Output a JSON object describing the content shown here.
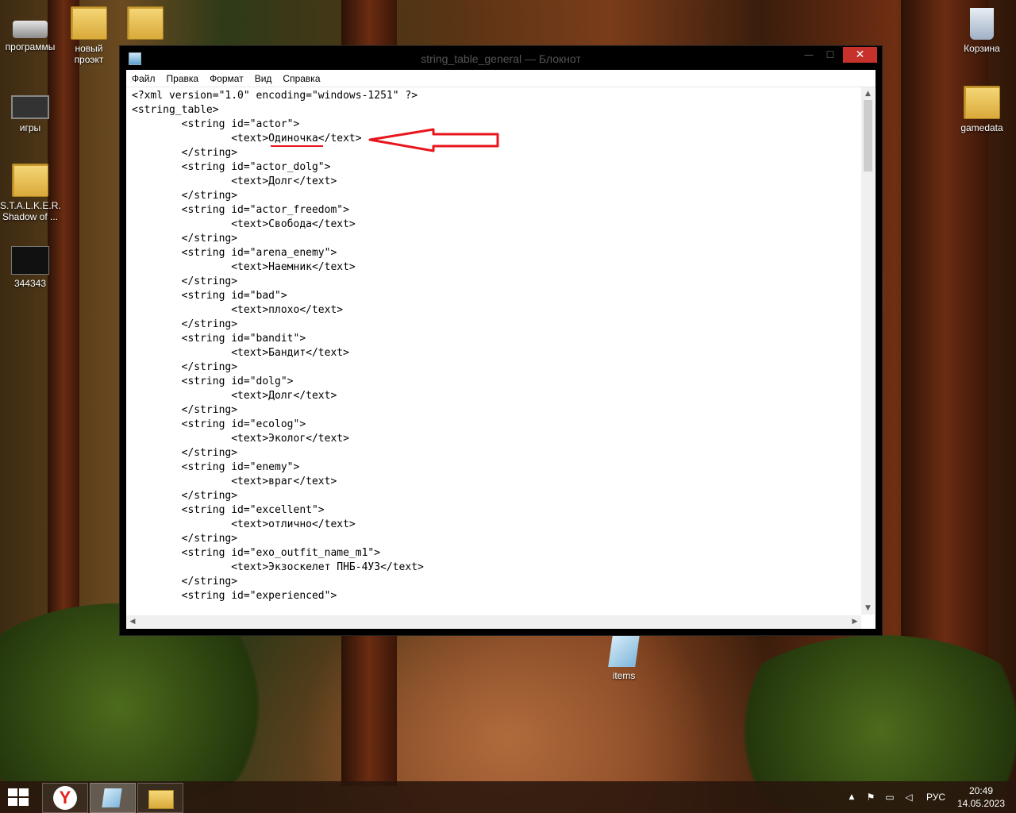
{
  "desktop": {
    "icons": [
      {
        "label": "программы",
        "icon": "drive-icon"
      },
      {
        "label": "новый\nпроэкт",
        "icon": "folder-icon"
      },
      {
        "label": "",
        "icon": "folder-icon"
      },
      {
        "label": "игры",
        "icon": "chip-icon"
      },
      {
        "label": "S.T.A.L.K.E.R.\nShadow of ...",
        "icon": "folder-icon"
      },
      {
        "label": "344343",
        "icon": "image-thumbnail-icon"
      },
      {
        "label": "Корзина",
        "icon": "recycle-bin-icon"
      },
      {
        "label": "gamedata",
        "icon": "folder-icon"
      },
      {
        "label": "items",
        "icon": "notepad-file-icon"
      }
    ]
  },
  "window": {
    "title": "string_table_general — Блокнот",
    "minimize": "—",
    "maximize": "☐",
    "close": "✕",
    "menu": [
      "Файл",
      "Правка",
      "Формат",
      "Вид",
      "Справка"
    ],
    "lines": [
      "<?xml version=\"1.0\" encoding=\"windows-1251\" ?>",
      "<string_table>",
      "        <string id=\"actor\">",
      "                <text>Одиночка</text>",
      "        </string>",
      "        <string id=\"actor_dolg\">",
      "                <text>Долг</text>",
      "        </string>",
      "        <string id=\"actor_freedom\">",
      "                <text>Свобода</text>",
      "        </string>",
      "        <string id=\"arena_enemy\">",
      "                <text>Наемник</text>",
      "        </string>",
      "        <string id=\"bad\">",
      "                <text>плохо</text>",
      "        </string>",
      "        <string id=\"bandit\">",
      "                <text>Бандит</text>",
      "        </string>",
      "        <string id=\"dolg\">",
      "                <text>Долг</text>",
      "        </string>",
      "        <string id=\"ecolog\">",
      "                <text>Эколог</text>",
      "        </string>",
      "        <string id=\"enemy\">",
      "                <text>враг</text>",
      "        </string>",
      "        <string id=\"excellent\">",
      "                <text>отлично</text>",
      "        </string>",
      "        <string id=\"exo_outfit_name_m1\">",
      "                <text>Экзоскелет ПНБ-4УЗ</text>",
      "        </string>",
      "        <string id=\"experienced\">"
    ]
  },
  "annotation": {
    "color": "#e8161c",
    "icon": "red-arrow-annotation"
  },
  "taskbar": {
    "start_icon": "windows-start-icon",
    "apps": [
      {
        "name": "yandex-browser",
        "glyph": "Y"
      },
      {
        "name": "notepad",
        "icon": "notepad-icon"
      },
      {
        "name": "file-explorer",
        "icon": "folder-icon"
      }
    ],
    "tray": {
      "expand": "▲",
      "language": "РУС",
      "time": "20:49",
      "date": "14.05.2023"
    }
  },
  "colors": {
    "close_button": "#c7312b",
    "taskbar": "#28160c"
  }
}
